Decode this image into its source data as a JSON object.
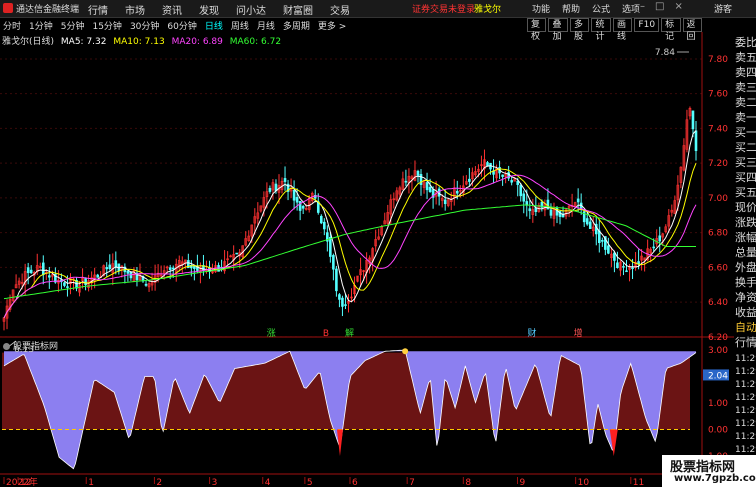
{
  "menubar": {
    "app_title": "通达信金融终端",
    "menus": [
      "行情",
      "市场",
      "资讯",
      "发现",
      "问小达",
      "财富圈",
      "交易"
    ],
    "notice": "证券交易未登录",
    "stock_name": "雅戈尔",
    "right_menus": [
      "功能",
      "帮助",
      "公式",
      "选项"
    ],
    "guest": "游客"
  },
  "periods": {
    "items": [
      "分时",
      "1分钟",
      "5分钟",
      "15分钟",
      "30分钟",
      "60分钟",
      "日线",
      "周线",
      "月线",
      "多周期",
      "更多 >"
    ],
    "active": "日线"
  },
  "toolbar": [
    "复权",
    "叠加",
    "多股",
    "统计",
    "画线",
    "F10",
    "标记",
    "返回"
  ],
  "chart_title": "雅戈尔(日线)",
  "ma": [
    {
      "label": "MA5: 7.32",
      "color": "#ffffff"
    },
    {
      "label": "MA10: 7.13",
      "color": "#ffff00"
    },
    {
      "label": "MA20: 6.89",
      "color": "#ff44ff"
    },
    {
      "label": "MA60: 6.72",
      "color": "#33ff33"
    }
  ],
  "right_panel": {
    "labels": [
      "委比",
      "卖五",
      "卖四",
      "卖三",
      "卖二",
      "卖一",
      "买一",
      "买二",
      "买三",
      "买四",
      "买五",
      "现价",
      "涨跌",
      "涨幅",
      "总量",
      "外盘",
      "换手",
      "净资",
      "收益",
      "自动",
      "行情"
    ],
    "times": [
      "11:29",
      "11:29",
      "11:29",
      "11:29",
      "11:29",
      "11:29",
      "11:29",
      "11:29",
      "11:29",
      "11:29"
    ]
  },
  "price_axis": [
    "7.80",
    "7.60",
    "7.40",
    "7.20",
    "7.00",
    "6.80",
    "6.60",
    "6.40",
    "6.20"
  ],
  "sub_axis": [
    "3.00",
    "2.04",
    "1.00",
    "0.00",
    "-1.00"
  ],
  "sub_current": "2.04",
  "date_axis": [
    "2022年",
    "12",
    "1",
    "2",
    "3",
    "4",
    "5",
    "6",
    "7",
    "8",
    "9",
    "10",
    "11",
    "12"
  ],
  "high_label": "7.84",
  "low_label": "6.13",
  "events": [
    {
      "text": "涨",
      "color": "#33dd33"
    },
    {
      "text": "B",
      "color": "#ff3333"
    },
    {
      "text": "解",
      "color": "#33dd33"
    },
    {
      "text": "财",
      "color": "#55ccff"
    },
    {
      "text": "增",
      "color": "#ff5555"
    }
  ],
  "sub_indicator": "股票指标网",
  "watermark": {
    "title": "股票指标网",
    "url": "www.7gpzb.com"
  },
  "chart_data": {
    "type": "candlestick",
    "title": "雅戈尔(日线)",
    "y_ticks": [
      6.2,
      6.4,
      6.6,
      6.8,
      7.0,
      7.2,
      7.4,
      7.6,
      7.8
    ],
    "ylim": [
      6.13,
      7.84
    ],
    "high": 7.84,
    "low": 6.13,
    "series": [
      {
        "name": "MA5",
        "color": "#ffffff",
        "last": 7.32
      },
      {
        "name": "MA10",
        "color": "#ffff00",
        "last": 7.13
      },
      {
        "name": "MA20",
        "color": "#ff44ff",
        "last": 6.89
      },
      {
        "name": "MA60",
        "color": "#33ff33",
        "last": 6.72
      }
    ],
    "ma60_knots": [
      [
        0,
        6.42
      ],
      [
        80,
        6.49
      ],
      [
        150,
        6.53
      ],
      [
        240,
        6.61
      ],
      [
        300,
        6.72
      ],
      [
        340,
        6.79
      ],
      [
        380,
        6.84
      ],
      [
        460,
        6.93
      ],
      [
        520,
        6.96
      ],
      [
        560,
        6.94
      ],
      [
        620,
        6.84
      ],
      [
        660,
        6.72
      ],
      [
        690,
        6.72
      ]
    ],
    "close_knots": [
      [
        0,
        6.31
      ],
      [
        8,
        6.48
      ],
      [
        20,
        6.55
      ],
      [
        35,
        6.6
      ],
      [
        55,
        6.52
      ],
      [
        75,
        6.5
      ],
      [
        95,
        6.56
      ],
      [
        108,
        6.62
      ],
      [
        125,
        6.57
      ],
      [
        145,
        6.5
      ],
      [
        160,
        6.6
      ],
      [
        175,
        6.63
      ],
      [
        195,
        6.58
      ],
      [
        215,
        6.6
      ],
      [
        235,
        6.67
      ],
      [
        250,
        6.9
      ],
      [
        265,
        7.05
      ],
      [
        280,
        7.1
      ],
      [
        295,
        6.92
      ],
      [
        310,
        7.02
      ],
      [
        322,
        6.75
      ],
      [
        335,
        6.38
      ],
      [
        345,
        6.44
      ],
      [
        360,
        6.62
      ],
      [
        378,
        6.86
      ],
      [
        393,
        7.08
      ],
      [
        410,
        7.16
      ],
      [
        425,
        7.02
      ],
      [
        440,
        6.98
      ],
      [
        460,
        7.1
      ],
      [
        478,
        7.2
      ],
      [
        495,
        7.13
      ],
      [
        510,
        7.08
      ],
      [
        525,
        6.9
      ],
      [
        540,
        6.95
      ],
      [
        555,
        6.88
      ],
      [
        570,
        6.98
      ],
      [
        585,
        6.82
      ],
      [
        600,
        6.72
      ],
      [
        615,
        6.6
      ],
      [
        630,
        6.62
      ],
      [
        645,
        6.7
      ],
      [
        655,
        6.78
      ],
      [
        665,
        6.9
      ],
      [
        675,
        7.18
      ],
      [
        683,
        7.55
      ],
      [
        690,
        7.3
      ]
    ],
    "sub_series": {
      "name": "股票指标网",
      "ylim": [
        -1.0,
        3.0
      ],
      "current": 2.04,
      "knots": [
        [
          0,
          2.4
        ],
        [
          20,
          2.85
        ],
        [
          40,
          0.9
        ],
        [
          55,
          -1.05
        ],
        [
          70,
          -1.5
        ],
        [
          90,
          1.9
        ],
        [
          110,
          1.4
        ],
        [
          125,
          -0.4
        ],
        [
          140,
          2.0
        ],
        [
          150,
          2.0
        ],
        [
          158,
          -0.2
        ],
        [
          170,
          2.0
        ],
        [
          185,
          0.6
        ],
        [
          200,
          2.1
        ],
        [
          215,
          1.0
        ],
        [
          230,
          2.3
        ],
        [
          260,
          2.5
        ],
        [
          285,
          2.95
        ],
        [
          300,
          1.5
        ],
        [
          315,
          2.2
        ],
        [
          325,
          0.4
        ],
        [
          335,
          -0.7
        ],
        [
          345,
          2.0
        ],
        [
          360,
          2.6
        ],
        [
          380,
          2.95
        ],
        [
          400,
          3.0
        ],
        [
          415,
          0.6
        ],
        [
          425,
          2.0
        ],
        [
          432,
          -0.8
        ],
        [
          440,
          2.0
        ],
        [
          450,
          0.8
        ],
        [
          460,
          2.4
        ],
        [
          470,
          1.0
        ],
        [
          480,
          2.2
        ],
        [
          490,
          -0.6
        ],
        [
          500,
          2.4
        ],
        [
          510,
          0.7
        ],
        [
          520,
          1.6
        ],
        [
          530,
          2.5
        ],
        [
          545,
          0.4
        ],
        [
          555,
          2.8
        ],
        [
          575,
          2.4
        ],
        [
          585,
          -0.8
        ],
        [
          592,
          1.0
        ],
        [
          600,
          -0.2
        ],
        [
          608,
          -0.9
        ],
        [
          615,
          1.4
        ],
        [
          625,
          2.5
        ],
        [
          640,
          0.4
        ],
        [
          650,
          -0.5
        ],
        [
          660,
          2.3
        ],
        [
          675,
          2.5
        ],
        [
          690,
          2.9
        ]
      ]
    }
  }
}
